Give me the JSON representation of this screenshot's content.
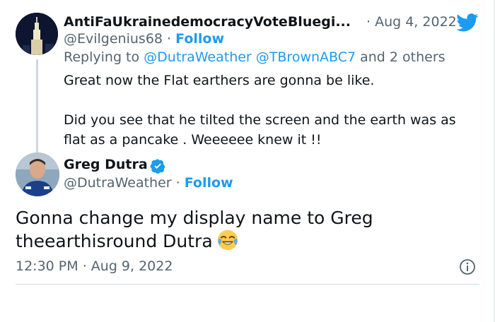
{
  "reply_tweet": {
    "display_name": "AntiFaUkrainedemocracyVoteBluegi...",
    "date": "· Aug 4, 2022",
    "handle": "@Evilgenius68",
    "separator": " · ",
    "follow_label": "Follow",
    "replying_prefix": "Replying to ",
    "replying_to": [
      "@DutraWeather",
      "@TBrownABC7"
    ],
    "replying_suffix": " and 2 others",
    "text_line1": "Great now the Flat earthers are gonna be like.",
    "text_line2": "Did you see that he tilted the screen and the earth was as flat as a pancake . Weeeeee knew it !!"
  },
  "main_tweet": {
    "display_name": "Greg Dutra",
    "handle": "@DutraWeather",
    "separator": " · ",
    "follow_label": "Follow",
    "text": "Gonna change my display name to Greg theearthisround Dutra",
    "emoji": "face-with-tears-of-joy",
    "time": "12:30 PM",
    "meta_separator": " · ",
    "date": "Aug 9, 2022"
  },
  "colors": {
    "link_blue": "#1d9bf0",
    "secondary_text": "#536471",
    "primary_text": "#0f1419",
    "thread_line": "#cfd9de"
  },
  "icons": {
    "brand": "twitter-bird-icon",
    "verified": "verified-badge-icon",
    "info": "info-icon"
  }
}
